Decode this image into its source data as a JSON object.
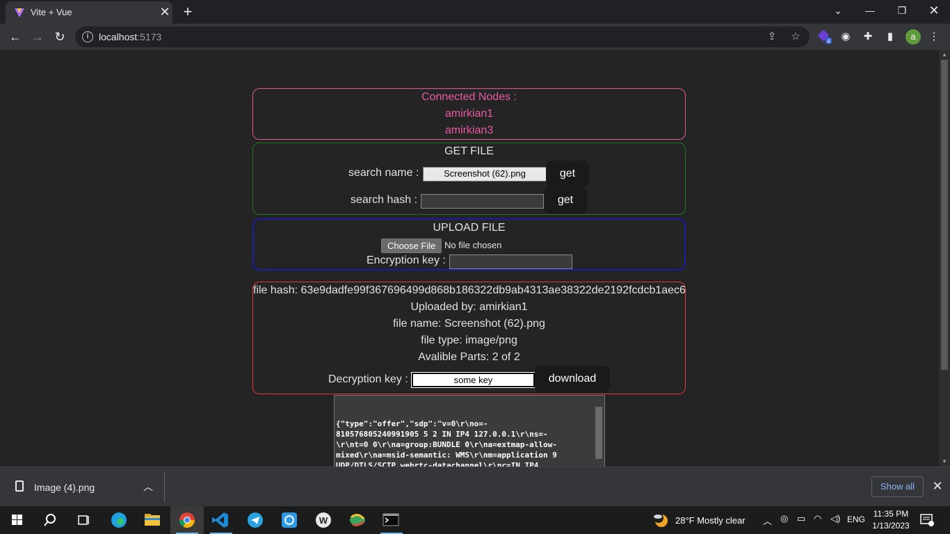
{
  "browser": {
    "tab_title": "Vite + Vue",
    "url_host": "localhost",
    "url_port": ":5173"
  },
  "page": {
    "connected": {
      "heading": "Connected Nodes :",
      "nodes": [
        "amirkian1",
        "amirkian3"
      ]
    },
    "get_file": {
      "heading": "GET FILE",
      "search_name_label": "search name :",
      "search_name_value": "Screenshot (62).png",
      "search_hash_label": "search hash :",
      "search_hash_value": "",
      "get_label": "get"
    },
    "upload_file": {
      "heading": "UPLOAD FILE",
      "choose_label": "Choose File",
      "no_file_text": "No file chosen",
      "enc_key_label": "Encryption key :",
      "enc_key_value": ""
    },
    "file_info": {
      "hash_line": "file hash: 63e9dadfe99f367696499d868b186322db9ab4313ae38322de2192fcdcb1aec6",
      "uploaded_line": "Uploaded by: amirkian1",
      "name_line": "file name: Screenshot (62).png",
      "type_line": "file type: image/png",
      "parts_line": "Avalible Parts: 2 of 2",
      "dec_key_label": "Decryption key :",
      "dec_key_value": "some key",
      "download_label": "download"
    },
    "sdp_text": "{\"type\":\"offer\",\"sdp\":\"v=0\\r\\no=-\n810576805240991905 5 2 IN IP4 127.0.0.1\\r\\ns=-\n\\r\\nt=0 0\\r\\na=group:BUNDLE 0\\r\\na=extmap-allow-\nmixed\\r\\na=msid-semantic: WMS\\r\\nm=application 9\nUDP/DTLS/SCTP webrtc-datachannel\\r\\nc=IN IP4"
  },
  "downloads": {
    "file_name": "Image (4).png",
    "show_all_label": "Show all"
  },
  "taskbar": {
    "weather": "28°F  Mostly clear",
    "lang": "ENG",
    "time": "11:35 PM",
    "date": "1/13/2023"
  }
}
